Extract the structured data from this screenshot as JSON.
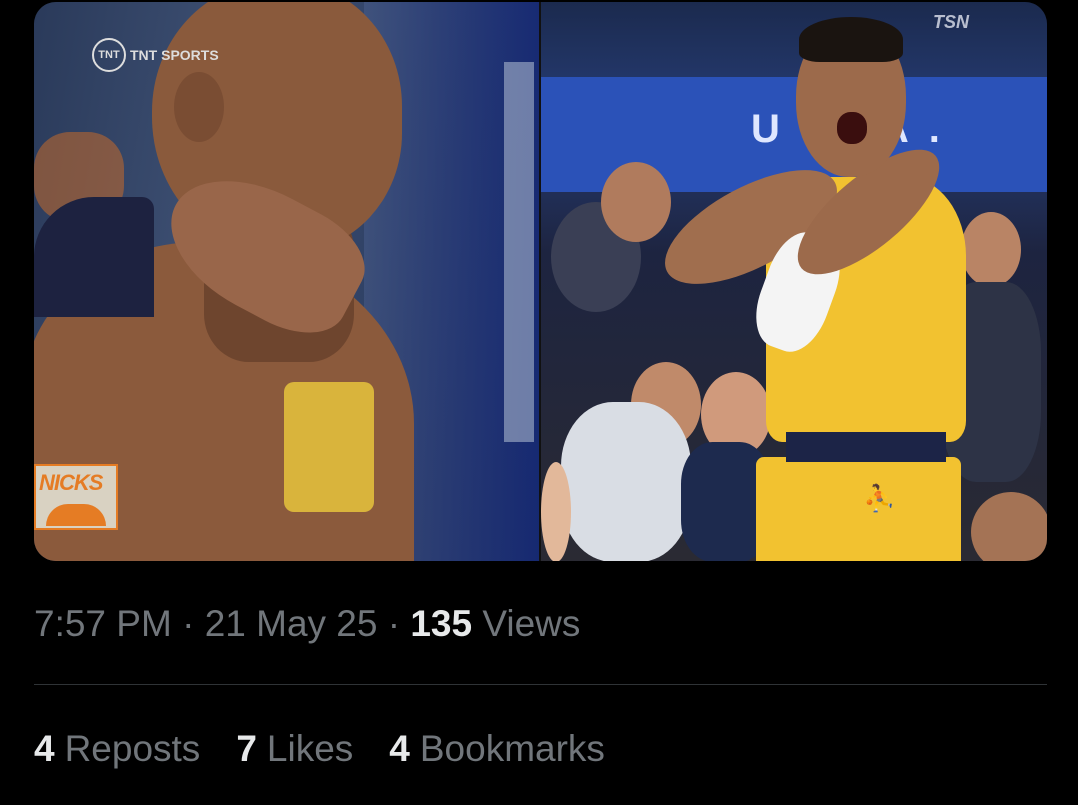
{
  "media": {
    "left_image": {
      "broadcaster_logo": "TNT SPORTS",
      "badge_text": "NICKS"
    },
    "right_image": {
      "broadcaster_logo": "TSN",
      "banner_text": "U  RA."
    }
  },
  "post": {
    "time": "7:57 PM",
    "separator": "·",
    "date": "21 May 25",
    "views_count": "135",
    "views_label": "Views"
  },
  "stats": {
    "reposts": {
      "count": "4",
      "label": "Reposts"
    },
    "likes": {
      "count": "7",
      "label": "Likes"
    },
    "bookmarks": {
      "count": "4",
      "label": "Bookmarks"
    }
  },
  "colors": {
    "background": "#000000",
    "text_primary": "#e7e9ea",
    "text_secondary": "#71767b",
    "divider": "#2f3336"
  }
}
